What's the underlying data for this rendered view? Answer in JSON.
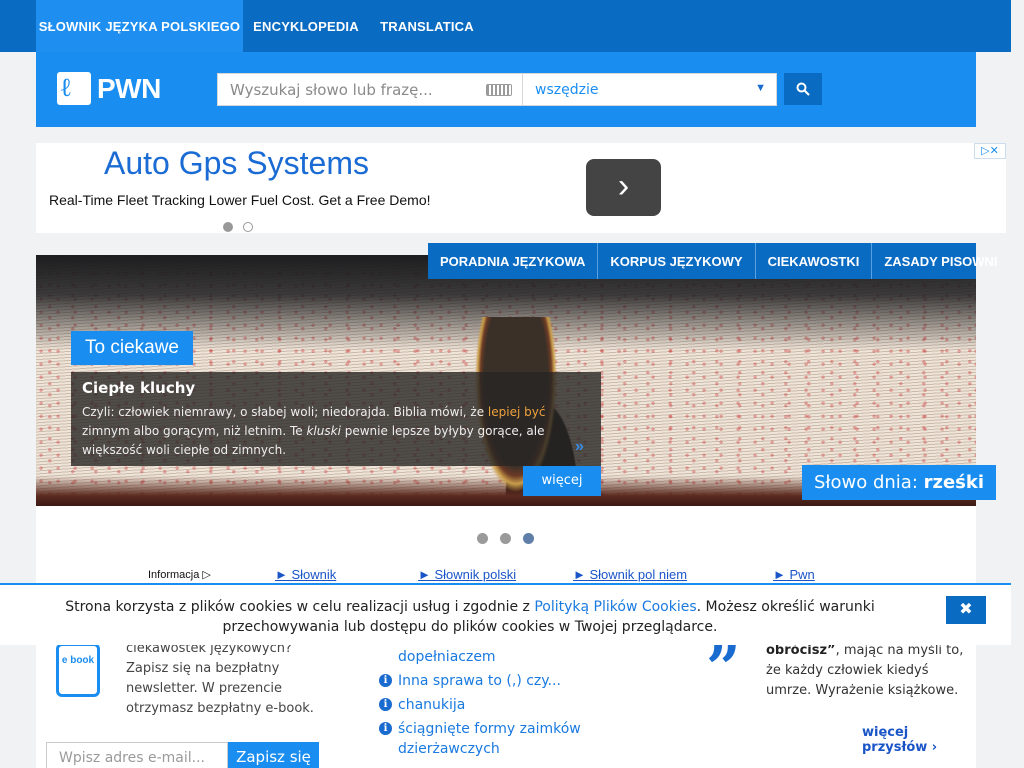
{
  "topnav": {
    "tabs": [
      "SŁOWNIK JĘZYKA POLSKIEGO",
      "ENCYKLOPEDIA",
      "TRANSLATICA"
    ]
  },
  "header": {
    "logo_text": "PWN",
    "search_placeholder": "Wyszukaj słowo lub frazę...",
    "scope_value": "wszędzie",
    "icons": {
      "keyboard": "keyboard-icon",
      "search": "search-icon",
      "dropdown": "chevron-down-icon"
    }
  },
  "ad": {
    "title": "Auto Gps Systems",
    "subtitle": "Real-Time Fleet Tracking Lower Fuel Cost. Get a Free Demo!",
    "badge": "▷✕"
  },
  "banner_nav": [
    "PORADNIA JĘZYKOWA",
    "KORPUS JĘZYKOWY",
    "CIEKAWOSTKI",
    "ZASADY PISOWNI"
  ],
  "slide": {
    "tag": "To ciekawe",
    "heading": "Ciepłe kluchy",
    "text_before": "Czyli: człowiek niemrawy, o słabej woli; niedorajda. Biblia mówi, że ",
    "text_highlight": "lepiej być",
    "text_mid": " zimnym albo gorącym, niż letnim. Te ",
    "text_italic": "kluski",
    "text_after": " pewnie lepsze byłyby gorące, ale większość woli ciepłe od zimnych.",
    "arrows": "»",
    "more_label": "więcej",
    "word_of_day_label": "Słowo dnia: ",
    "word_of_day": "rześki"
  },
  "links_row": {
    "info": "Informacja ▷",
    "links": [
      "► Słownik",
      "► Słownik polski",
      "► Słownik pol niem",
      "► Pwn"
    ]
  },
  "cookie": {
    "text_before": "Strona korzysta z plików cookies w celu realizacji usług i zgodnie z ",
    "link": "Polityką Plików Cookies",
    "text_after": ". Możesz określić warunki przechowywania lub dostępu do plików cookies w Twojej przeglądarce.",
    "close": "✖"
  },
  "newsletter": {
    "ebook_label": "e book",
    "text": "Chcesz otrzymywać więcej ciekawostek językowych? Zapisz się na bezpłatny newsletter. W prezencie otrzymasz bezpłatny e-book.",
    "email_placeholder": "Wpisz adres e-mail...",
    "subscribe": "Zapisz się"
  },
  "advice": {
    "first_tail": "dopełniaczem",
    "items": [
      "Inna sprawa to (,) czy...",
      "chanukija",
      "ściągnięte formy zaimków dzierżawczych"
    ]
  },
  "proverb": {
    "bold": "(powstałeś) i w proch się obrócisz”",
    "rest": ", mając na myśli to, że każdy człowiek kiedyś umrze. Wyrażenie książkowe.",
    "more": "więcej przysłów ›"
  }
}
